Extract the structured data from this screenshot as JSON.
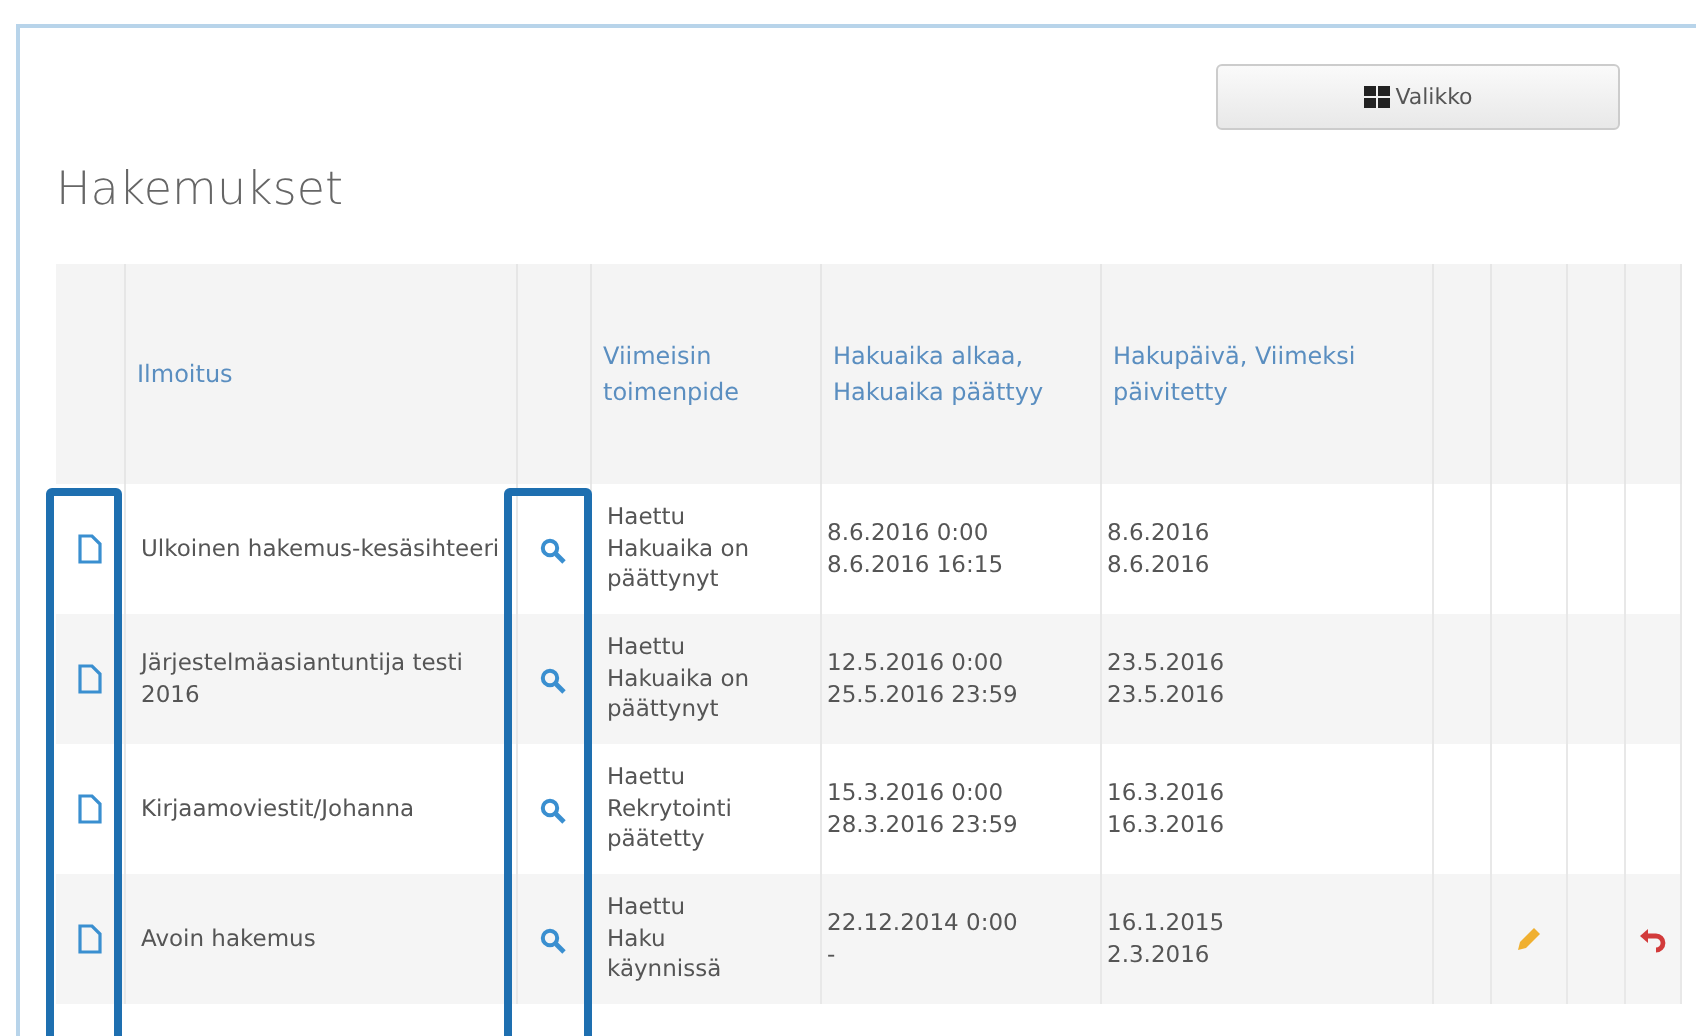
{
  "title": "Hakemukset",
  "menu_button": {
    "label": "Valikko"
  },
  "table": {
    "columns": [
      "Ilmoitus",
      "Viimeisin toimenpide",
      "Hakuaika alkaa, Hakuaika päättyy",
      "Hakupäivä, Viimeksi päivitetty"
    ],
    "rows": [
      {
        "title": "Ulkoinen hakemus-kesäsihteeri",
        "action": [
          "Haettu",
          "Hakuaika on",
          "päättynyt"
        ],
        "period": [
          "8.6.2016 0:00",
          "8.6.2016 16:15"
        ],
        "dates": [
          "8.6.2016",
          "8.6.2016"
        ],
        "editable": false,
        "undoable": false
      },
      {
        "title": "Järjestelmäasiantuntija testi 2016",
        "action": [
          "Haettu",
          "Hakuaika on",
          "päättynyt"
        ],
        "period": [
          "12.5.2016 0:00",
          "25.5.2016 23:59"
        ],
        "dates": [
          "23.5.2016",
          "23.5.2016"
        ],
        "editable": false,
        "undoable": false
      },
      {
        "title": "Kirjaamoviestit/Johanna",
        "action": [
          "Haettu",
          "Rekrytointi",
          "päätetty"
        ],
        "period": [
          "15.3.2016 0:00",
          "28.3.2016 23:59"
        ],
        "dates": [
          "16.3.2016",
          "16.3.2016"
        ],
        "editable": false,
        "undoable": false
      },
      {
        "title": "Avoin hakemus",
        "action": [
          "Haettu",
          "Haku",
          "käynnissä"
        ],
        "period": [
          "22.12.2014 0:00",
          "-"
        ],
        "dates": [
          "16.1.2015",
          "2.3.2016"
        ],
        "editable": true,
        "undoable": true
      }
    ]
  }
}
